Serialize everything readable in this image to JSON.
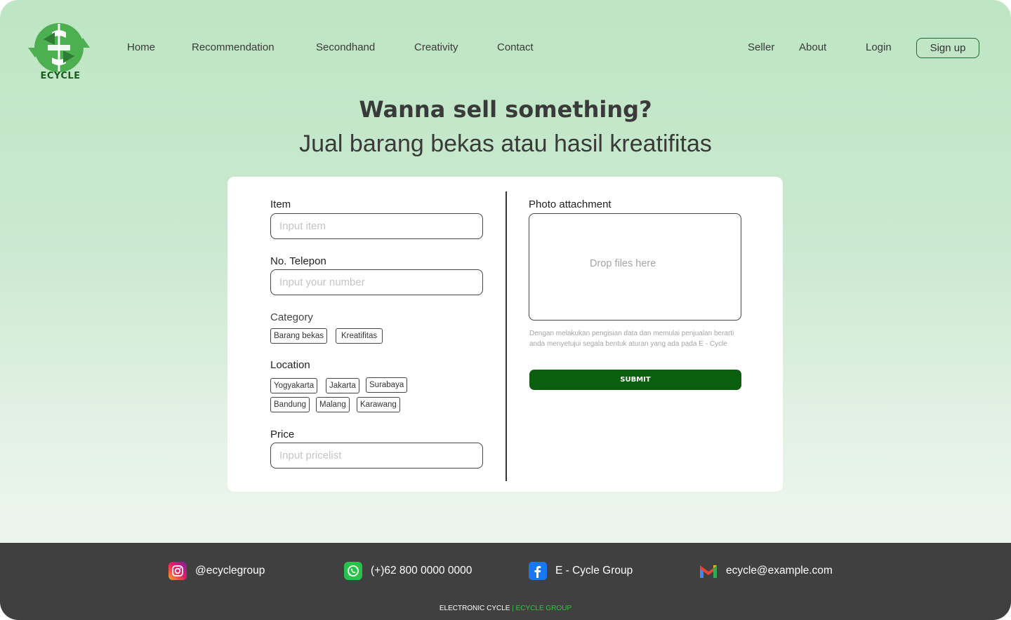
{
  "brand": {
    "logo_text": "ECYCLE"
  },
  "nav": {
    "links": [
      "Home",
      "Recommendation",
      "Secondhand",
      "Creativity",
      "Contact"
    ],
    "seller": "Seller",
    "about": "About",
    "login": "Login",
    "signup": "Sign up"
  },
  "hero": {
    "title": "Wanna sell something?",
    "subtitle": "Jual barang bekas atau hasil kreatifitas"
  },
  "form": {
    "item": {
      "label": "Item",
      "placeholder": "Input item"
    },
    "phone": {
      "label": "No. Telepon",
      "placeholder": "Input your number"
    },
    "category": {
      "label": "Category",
      "options": [
        "Barang bekas",
        "Kreatifitas"
      ]
    },
    "location": {
      "label": "Location",
      "options": [
        "Yogyakarta",
        "Jakarta",
        "Surabaya",
        "Bandung",
        "Malang",
        "Karawang"
      ]
    },
    "price": {
      "label": "Price",
      "placeholder": "Input pricelist"
    },
    "photo": {
      "label": "Photo attachment",
      "dropzone_text": "Drop files here"
    },
    "disclaimer": "Dengan melakukan pengisian data dan memulai penjualan berarti anda menyetujui segala bentuk aturan yang ada pada E - Cycle",
    "submit": "SUBMIT"
  },
  "footer": {
    "instagram": "@ecyclegroup",
    "whatsapp": "(+)62 800 0000 0000",
    "facebook": "E - Cycle Group",
    "email": "ecycle@example.com",
    "credit_left": "ELECTRONIC CYCLE",
    "credit_sep": " | ",
    "credit_right": "ECYCLE GROUP"
  },
  "colors": {
    "accent": "#0b5e0d",
    "logo_green": "#4caf50",
    "footer_bg": "#404040",
    "credit_green": "#35c23e"
  },
  "icons": [
    "recycle-logo-icon",
    "instagram-icon",
    "whatsapp-icon",
    "facebook-icon",
    "gmail-icon"
  ]
}
